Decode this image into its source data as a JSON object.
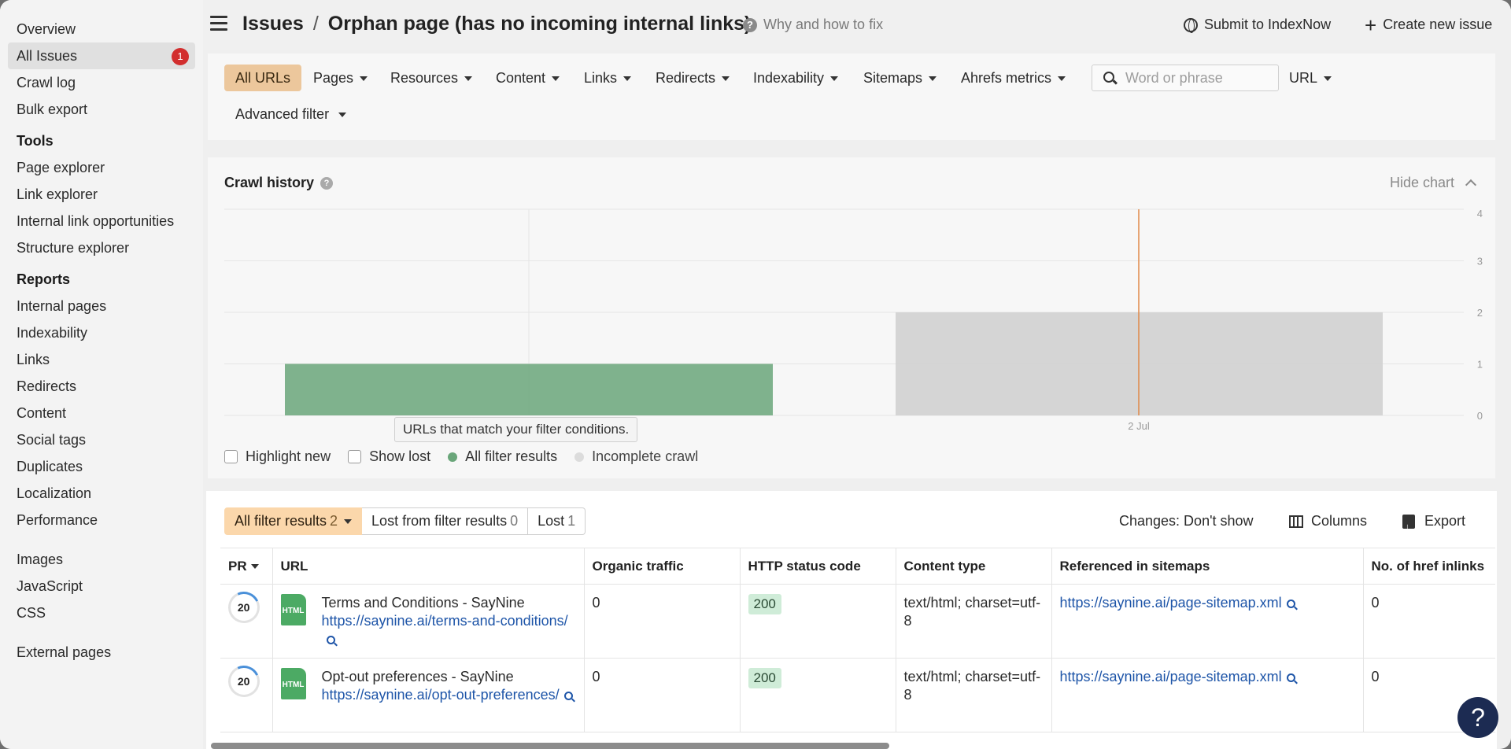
{
  "sidebar": {
    "top_items": [
      {
        "label": "Overview"
      },
      {
        "label": "All Issues",
        "badge": "1",
        "active": true
      },
      {
        "label": "Crawl log"
      },
      {
        "label": "Bulk export"
      }
    ],
    "tools_heading": "Tools",
    "tools": [
      "Page explorer",
      "Link explorer",
      "Internal link opportunities",
      "Structure explorer"
    ],
    "reports_heading": "Reports",
    "reports": [
      "Internal pages",
      "Indexability",
      "Links",
      "Redirects",
      "Content",
      "Social tags",
      "Duplicates",
      "Localization",
      "Performance"
    ],
    "resources": [
      "Images",
      "JavaScript",
      "CSS"
    ],
    "external": "External pages"
  },
  "header": {
    "crumb_root": "Issues",
    "crumb_sep": "/",
    "crumb_current": "Orphan page (has no incoming internal links)",
    "why_label": "Why and how to fix",
    "submit_label": "Submit to IndexNow",
    "create_label": "Create new issue",
    "create_icon": "+"
  },
  "filters": {
    "all_urls": "All URLs",
    "items": [
      "Pages",
      "Resources",
      "Content",
      "Links",
      "Redirects",
      "Indexability",
      "Sitemaps",
      "Ahrefs metrics"
    ],
    "search_placeholder": "Word or phrase",
    "url_label": "URL",
    "advanced": "Advanced filter"
  },
  "chart": {
    "title": "Crawl history",
    "hide_label": "Hide chart",
    "tooltip": "URLs that match your filter conditions.",
    "legend": {
      "highlight_new": "Highlight new",
      "show_lost": "Show lost",
      "all_filter_results": "All filter results",
      "incomplete_crawl": "Incomplete crawl"
    },
    "colors": {
      "filter_results": "#6aa67a",
      "incomplete": "#cfcfcf",
      "marker": "#e08a4a"
    }
  },
  "chart_data": {
    "type": "bar",
    "title": "Crawl history",
    "ylim": [
      0,
      4
    ],
    "yticks": [
      "0",
      "1",
      "2",
      "3",
      "4"
    ],
    "xtick_label": "2 Jul",
    "series": [
      {
        "name": "All filter results",
        "values": [
          1
        ]
      },
      {
        "name": "Incomplete crawl",
        "values": [
          2
        ]
      }
    ],
    "grid": true
  },
  "table_panel": {
    "tabs": [
      {
        "label": "All filter results",
        "count": "2",
        "selected": true
      },
      {
        "label": "Lost from filter results",
        "count": "0"
      },
      {
        "label": "Lost",
        "count": "1"
      }
    ],
    "changes_label": "Changes: Don't show",
    "columns_label": "Columns",
    "export_label": "Export",
    "headers": {
      "pr": "PR",
      "url": "URL",
      "organic": "Organic traffic",
      "status": "HTTP status code",
      "ctype": "Content type",
      "sitemaps": "Referenced in sitemaps",
      "inlinks": "No. of href inlinks"
    },
    "rows": [
      {
        "pr": "20",
        "file_type": "HTML",
        "title": "Terms and Conditions - SayNine",
        "url": "https://saynine.ai/terms-and-conditions/",
        "organic": "0",
        "status": "200",
        "ctype": "text/html; charset=utf-8",
        "sitemap": "https://saynine.ai/page-sitemap.xml",
        "inlinks": "0"
      },
      {
        "pr": "20",
        "file_type": "HTML",
        "title": "Opt-out preferences - SayNine",
        "url": "https://saynine.ai/opt-out-preferences/",
        "organic": "0",
        "status": "200",
        "ctype": "text/html; charset=utf-8",
        "sitemap": "https://saynine.ai/page-sitemap.xml",
        "inlinks": "0"
      }
    ]
  },
  "help_label": "?"
}
